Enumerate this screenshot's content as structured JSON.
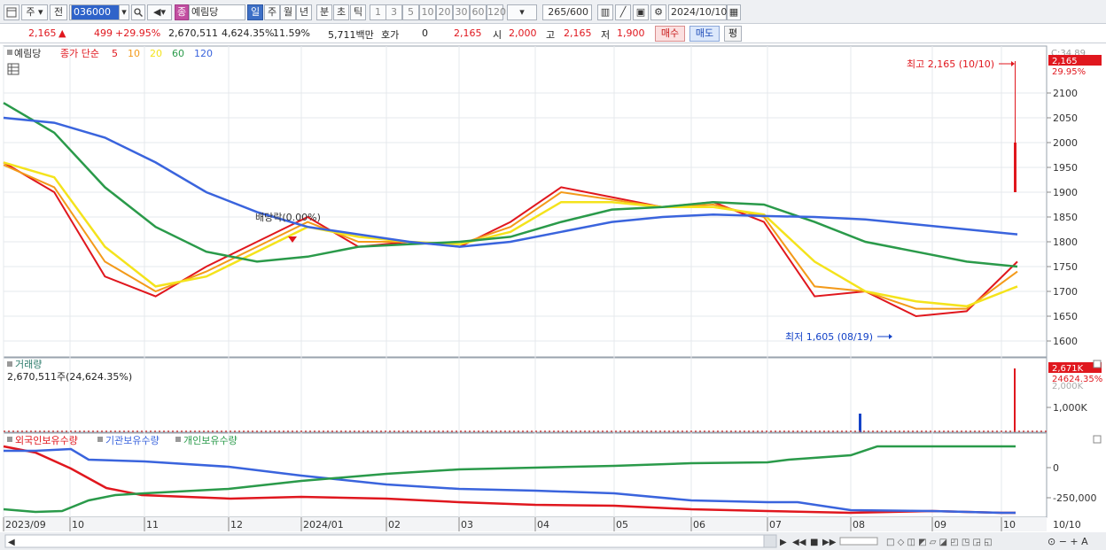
{
  "toolbar": {
    "period_label": "주",
    "prev_label": "전",
    "code": "036000",
    "code_badge": "종",
    "stock_name": "예림당",
    "period_buttons": [
      "일",
      "주",
      "월",
      "년",
      "분",
      "초",
      "틱"
    ],
    "number_buttons": [
      "1",
      "3",
      "5",
      "10",
      "20",
      "30",
      "60",
      "120"
    ],
    "count_value": "265",
    "count_total": "/600",
    "date_value": "2024/10/10"
  },
  "info": {
    "price": "2,165",
    "change": "499",
    "change_pct": "+29.95%",
    "volume": "2,670,511",
    "volume_ratio": "4,624.35%",
    "turnover": "11.59%",
    "amount": "5,711백만",
    "quote_label": "호가",
    "quote_value": "0",
    "quote_price": "2,165",
    "open_label": "시",
    "open_value": "2,000",
    "high_label": "고",
    "high_value": "2,165",
    "low_label": "저",
    "low_value": "1,900",
    "buy_label": "매수",
    "sell_label": "매도",
    "eval_label": "평"
  },
  "price_pane": {
    "stock_label": "예림당",
    "ma_title": "종가 단순",
    "ma_periods": [
      "5",
      "10",
      "20",
      "60",
      "120"
    ],
    "ma_colors": [
      "#e0171e",
      "#f39a1a",
      "#f4e31c",
      "#2a9a4a",
      "#3a64dd"
    ],
    "max_label": "최고 2,165 (10/10)",
    "min_label": "최저 1,605 (08/19)",
    "dividend_label": "배당락(0.00%)",
    "current_price_tag": "2,165",
    "current_pct_tag": "29.95%",
    "top_clipped": "C:34.89"
  },
  "volume_pane": {
    "title": "거래량",
    "summary": "2,670,511주(24,624.35%)",
    "tag_value": "2,671K",
    "tag_pct": "24624.35%",
    "clipped_tick": "2,000K",
    "tick": "1,000K"
  },
  "holding_pane": {
    "series": [
      "외국인보유수량",
      "기관보유수량",
      "개인보유수량"
    ],
    "series_colors": [
      "#e0171e",
      "#3a64dd",
      "#2a9a4a"
    ],
    "ticks": [
      "0",
      "-250,000"
    ]
  },
  "x_axis": [
    "2023/09",
    "10",
    "11",
    "12",
    "2024/01",
    "02",
    "03",
    "04",
    "05",
    "06",
    "07",
    "08",
    "09",
    "10"
  ],
  "x_axis_right": "10/10",
  "chart_data": {
    "type": "line",
    "title": "",
    "y_ticks": [
      2100,
      2050,
      2000,
      1950,
      1900,
      1850,
      1800,
      1750,
      1700,
      1650,
      1600
    ],
    "ylim": [
      1575,
      2200
    ],
    "x_positions": [
      0,
      0.05,
      0.1,
      0.15,
      0.2,
      0.25,
      0.3,
      0.35,
      0.4,
      0.45,
      0.5,
      0.55,
      0.6,
      0.65,
      0.7,
      0.75,
      0.8,
      0.85,
      0.9,
      0.95,
      1.0
    ],
    "series": [
      {
        "name": "5",
        "values": [
          1960,
          1900,
          1730,
          1690,
          1750,
          1800,
          1850,
          1790,
          1800,
          1790,
          1840,
          1910,
          1890,
          1870,
          1880,
          1840,
          1690,
          1700,
          1650,
          1660,
          1760
        ]
      },
      {
        "name": "10",
        "values": [
          1955,
          1910,
          1760,
          1700,
          1740,
          1790,
          1840,
          1800,
          1800,
          1795,
          1830,
          1900,
          1885,
          1870,
          1875,
          1850,
          1710,
          1700,
          1665,
          1665,
          1740
        ]
      },
      {
        "name": "20",
        "values": [
          1960,
          1930,
          1790,
          1710,
          1730,
          1780,
          1830,
          1810,
          1800,
          1795,
          1820,
          1880,
          1880,
          1870,
          1870,
          1855,
          1760,
          1700,
          1680,
          1670,
          1710
        ]
      },
      {
        "name": "60",
        "values": [
          2080,
          2020,
          1910,
          1830,
          1780,
          1760,
          1770,
          1790,
          1795,
          1800,
          1810,
          1840,
          1865,
          1870,
          1880,
          1875,
          1840,
          1800,
          1780,
          1760,
          1750
        ]
      },
      {
        "name": "120",
        "values": [
          2050,
          2040,
          2010,
          1960,
          1900,
          1860,
          1830,
          1815,
          1800,
          1790,
          1800,
          1820,
          1840,
          1850,
          1855,
          1852,
          1850,
          1845,
          1835,
          1825,
          1815
        ]
      }
    ]
  }
}
